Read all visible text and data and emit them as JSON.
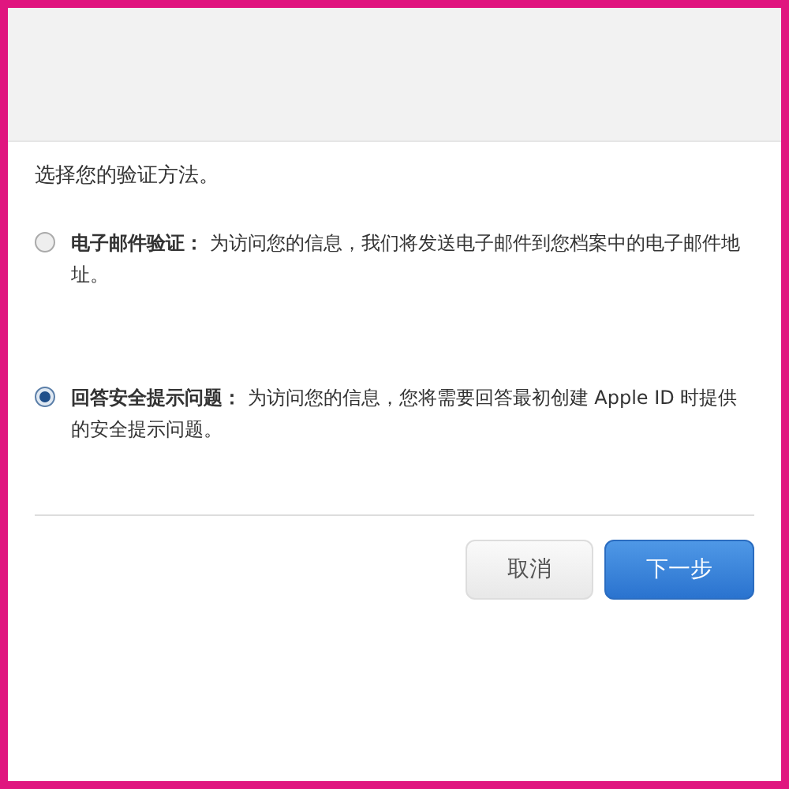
{
  "prompt": "选择您的验证方法。",
  "options": [
    {
      "text": "**电子邮件验证：** 为访问您的信息，我们将发送电子邮件到您档案中的电子邮件地址。",
      "selected": false
    },
    {
      "text": "**回答安全提示问题：** 为访问您的信息，您将需要回答最初创建 Apple ID 时提供的安全提示问题。",
      "selected": true
    }
  ],
  "buttons": [
    {
      "label": "取消",
      "kind": "secondary"
    },
    {
      "label": "下一步",
      "kind": "primary"
    }
  ]
}
